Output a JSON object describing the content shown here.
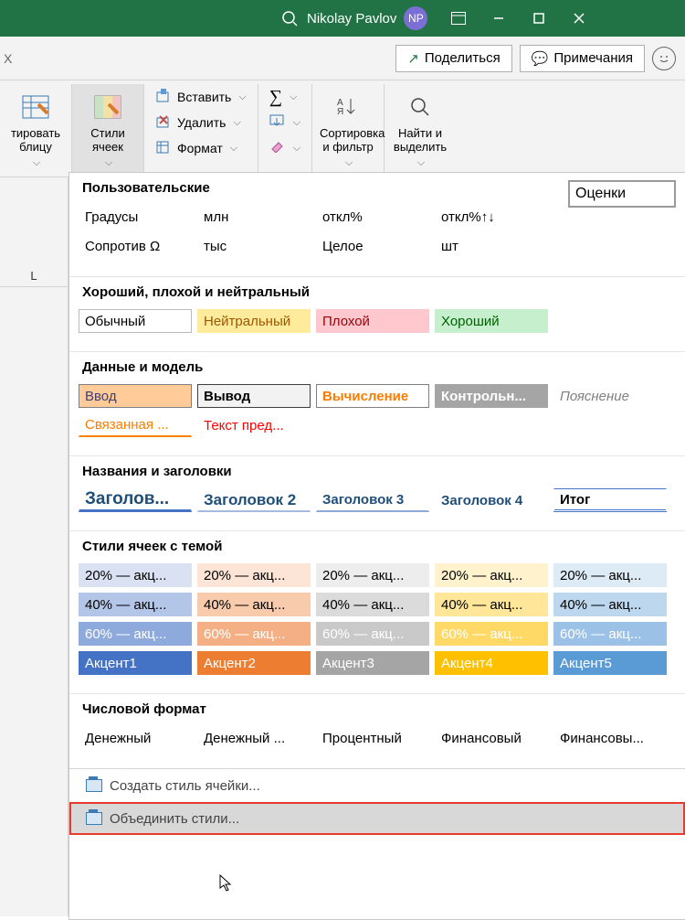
{
  "titlebar": {
    "userName": "Nikolay Pavlov",
    "initials": "NP"
  },
  "sharebar": {
    "share": "Поделиться",
    "comments": "Примечания"
  },
  "ribbon": {
    "formatTable": "тировать\nблицу",
    "cellStyles": "Стили\nячеек",
    "insert": "Вставить",
    "delete": "Удалить",
    "format": "Формат",
    "sortFilter": "Сортировка\nи фильтр",
    "findSelect": "Найти и\nвыделить"
  },
  "searchLabel": "Оценки",
  "s1": {
    "title": "Пользовательские",
    "r1": [
      "Градусы",
      "млн",
      "откл%",
      "откл%↑↓"
    ],
    "r2": [
      "Сопротив Ω",
      "тыс",
      "Целое",
      "шт"
    ]
  },
  "s2": {
    "title": "Хороший, плохой и нейтральный",
    "items": [
      "Обычный",
      "Нейтральный",
      "Плохой",
      "Хороший"
    ]
  },
  "s3": {
    "title": "Данные и модель",
    "r1": [
      "Ввод",
      "Вывод",
      "Вычисление",
      "Контрольн...",
      "Пояснение"
    ],
    "r2": [
      "Связанная ...",
      "Текст пред..."
    ]
  },
  "s4": {
    "title": "Названия и заголовки",
    "items": [
      "Заголов...",
      "Заголовок 2",
      "Заголовок 3",
      "Заголовок 4",
      "Итог"
    ]
  },
  "s5": {
    "title": "Стили ячеек с темой",
    "r1": [
      "20% — акц...",
      "20% — акц...",
      "20% — акц...",
      "20% — акц...",
      "20% — акц..."
    ],
    "r2": [
      "40% — акц...",
      "40% — акц...",
      "40% — акц...",
      "40% — акц...",
      "40% — акц..."
    ],
    "r3": [
      "60% — акц...",
      "60% — акц...",
      "60% — акц...",
      "60% — акц...",
      "60% — акц..."
    ],
    "r4": [
      "Акцент1",
      "Акцент2",
      "Акцент3",
      "Акцент4",
      "Акцент5"
    ]
  },
  "s6": {
    "title": "Числовой формат",
    "items": [
      "Денежный",
      "Денежный ...",
      "Процентный",
      "Финансовый",
      "Финансовы..."
    ]
  },
  "cmds": {
    "new": "Создать стиль ячейки...",
    "merge": "Объединить стили..."
  },
  "colL": "L"
}
